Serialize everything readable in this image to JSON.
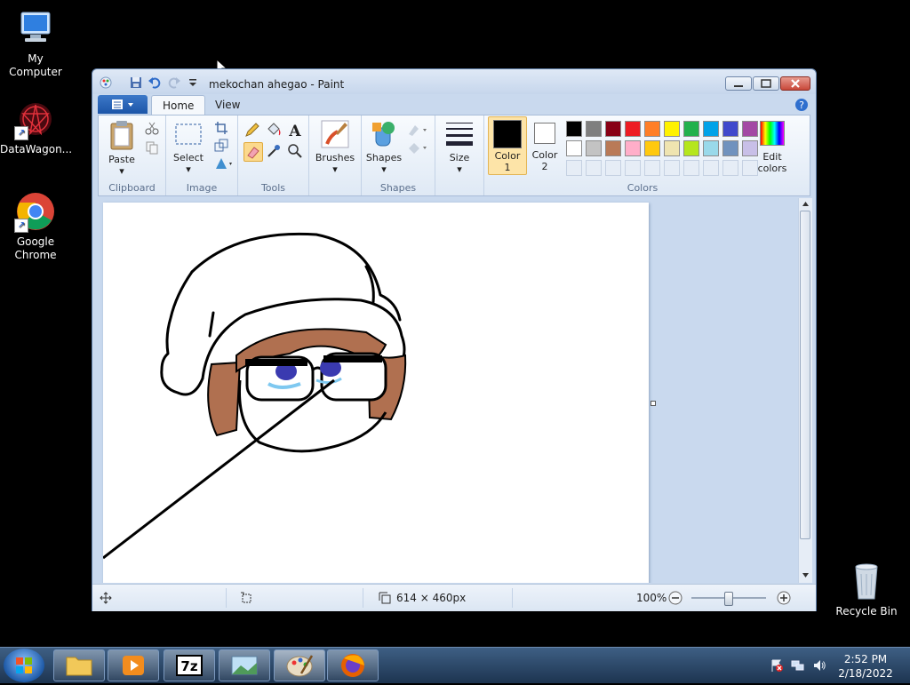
{
  "desktop": {
    "icons": [
      {
        "label": "My Computer"
      },
      {
        "label": "DataWagon..."
      },
      {
        "label": "Google Chrome"
      },
      {
        "label": "Recycle Bin"
      }
    ]
  },
  "window": {
    "title": "mekochan ahegao - Paint",
    "tabs": [
      {
        "label": "Home"
      },
      {
        "label": "View"
      }
    ]
  },
  "ribbon": {
    "groups": {
      "clipboard": "Clipboard",
      "image": "Image",
      "tools": "Tools",
      "shapes": "Shapes",
      "colors": "Colors"
    },
    "buttons": {
      "paste": "Paste",
      "select": "Select",
      "brushes": "Brushes",
      "shapes": "Shapes",
      "size": "Size",
      "color1_line1": "Color",
      "color1_line2": "1",
      "color2_line1": "Color",
      "color2_line2": "2",
      "edit_colors_line1": "Edit",
      "edit_colors_line2": "colors"
    },
    "color1": "#000000",
    "color2": "#ffffff",
    "palette": [
      "#000000",
      "#7f7f7f",
      "#880015",
      "#ed1c24",
      "#ff7f27",
      "#fff200",
      "#22b14c",
      "#00a2e8",
      "#3f48cc",
      "#a349a4",
      "#ffffff",
      "#c3c3c3",
      "#b97a57",
      "#ffaec9",
      "#ffc90e",
      "#efe4b0",
      "#b5e61d",
      "#99d9ea",
      "#7092be",
      "#c8bfe7"
    ]
  },
  "status": {
    "dimensions": "614 × 460px",
    "zoom": "100%"
  },
  "taskbar": {
    "time": "2:52 PM",
    "date": "2/18/2022"
  }
}
